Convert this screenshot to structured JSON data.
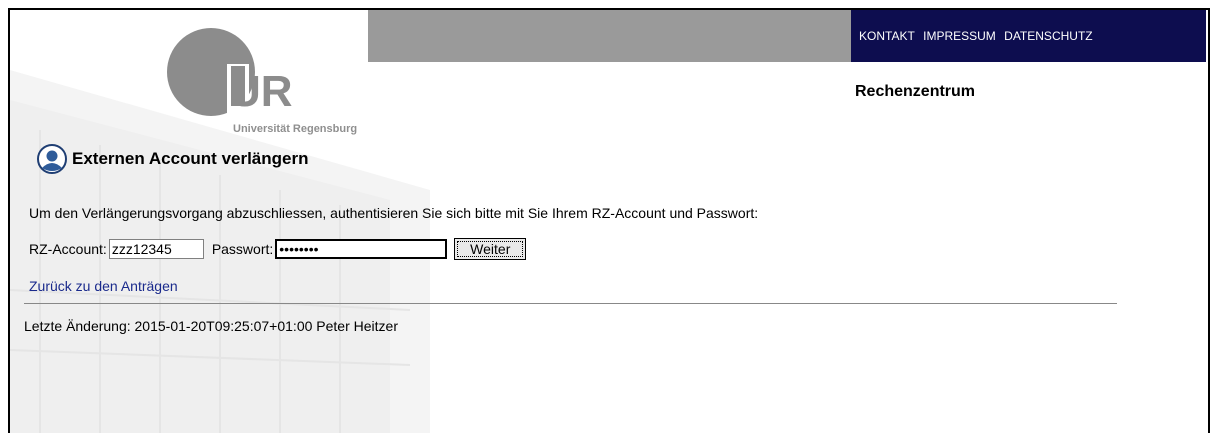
{
  "header": {
    "nav_links": [
      "KONTAKT",
      "IMPRESSUM",
      "DATENSCHUTZ"
    ],
    "logo_letters": "UR",
    "logo_caption": "Universität Regensburg",
    "department": "Rechenzentrum"
  },
  "page": {
    "title": "Externen Account verlängern",
    "title_icon": "user-avatar-icon",
    "instructions": "Um den Verlängerungsvorgang abzuschliessen, authentisieren Sie sich bitte mit Sie Ihrem RZ-Account und Passwort:"
  },
  "form": {
    "account_label": "RZ-Account:",
    "account_value": "zzz12345",
    "password_label": "Passwort:",
    "password_value": "••••••••",
    "submit_label": "Weiter"
  },
  "back_link": "Zurück zu den Anträgen",
  "footer": {
    "last_modified": "Letzte Änderung: 2015-01-20T09:25:07+01:00 Peter Heitzer"
  },
  "colors": {
    "nav_band": "#0d0d4f",
    "grey_band": "#9a9a9a",
    "link": "#1a2a8c"
  }
}
